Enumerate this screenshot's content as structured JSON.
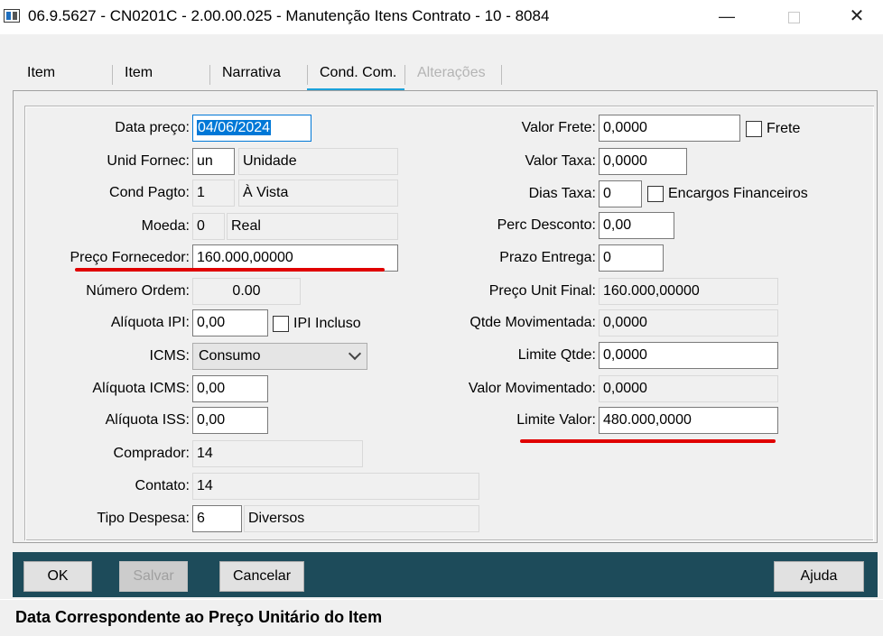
{
  "window": {
    "title": "06.9.5627 - CN0201C - 2.00.00.025 - Manutenção Itens Contrato - 10 - 8084",
    "controls": {
      "minimize": "—",
      "close": "✕"
    }
  },
  "tabs": [
    {
      "label": "Item",
      "state": "normal"
    },
    {
      "label": "Item",
      "state": "normal"
    },
    {
      "label": "Narrativa",
      "state": "normal"
    },
    {
      "label": "Cond. Com.",
      "state": "active"
    },
    {
      "label": "Alterações",
      "state": "disabled"
    }
  ],
  "form_left": {
    "data_preco": {
      "label": "Data preço:",
      "value": "04/06/2024"
    },
    "unid_fornec": {
      "label": "Unid Fornec:",
      "value": "un",
      "desc": "Unidade"
    },
    "cond_pagto": {
      "label": "Cond Pagto:",
      "value": "1",
      "desc": "À Vista"
    },
    "moeda": {
      "label": "Moeda:",
      "value": "0",
      "desc": "Real"
    },
    "preco_fornecedor": {
      "label": "Preço Fornecedor:",
      "value": "160.000,00000"
    },
    "numero_ordem": {
      "label": "Número Ordem:",
      "value": "0.00"
    },
    "aliquota_ipi": {
      "label": "Alíquota IPI:",
      "value": "0,00",
      "check_label": "IPI Incluso",
      "checked": false
    },
    "icms": {
      "label": "ICMS:",
      "value": "Consumo"
    },
    "aliquota_icms": {
      "label": "Alíquota ICMS:",
      "value": "0,00"
    },
    "aliquota_iss": {
      "label": "Alíquota ISS:",
      "value": "0,00"
    },
    "comprador": {
      "label": "Comprador:",
      "value": "14"
    },
    "contato": {
      "label": "Contato:",
      "value": "14"
    },
    "tipo_despesa": {
      "label": "Tipo Despesa:",
      "value": "6",
      "desc": "Diversos"
    }
  },
  "form_right": {
    "valor_frete": {
      "label": "Valor Frete:",
      "value": "0,0000",
      "check_label": "Frete",
      "checked": false
    },
    "valor_taxa": {
      "label": "Valor Taxa:",
      "value": "0,0000"
    },
    "dias_taxa": {
      "label": "Dias Taxa:",
      "value": "0",
      "check_label": "Encargos Financeiros",
      "checked": false
    },
    "perc_desconto": {
      "label": "Perc Desconto:",
      "value": "0,00"
    },
    "prazo_entrega": {
      "label": "Prazo Entrega:",
      "value": "0"
    },
    "preco_unit_final": {
      "label": "Preço Unit Final:",
      "value": "160.000,00000"
    },
    "qtde_movimentada": {
      "label": "Qtde Movimentada:",
      "value": "0,0000"
    },
    "limite_qtde": {
      "label": "Limite Qtde:",
      "value": "0,0000"
    },
    "valor_movimentado": {
      "label": "Valor Movimentado:",
      "value": "0,0000"
    },
    "limite_valor": {
      "label": "Limite Valor:",
      "value": "480.000,0000"
    }
  },
  "buttons": {
    "ok": "OK",
    "salvar": "Salvar",
    "cancelar": "Cancelar",
    "ajuda": "Ajuda"
  },
  "status": {
    "text": "Data Correspondente ao Preço Unitário do Item"
  },
  "colors": {
    "accent": "#1ba1d9",
    "button_bar": "#1d4b5a",
    "highlight_underline": "#e00000",
    "selection": "#0078d7"
  }
}
